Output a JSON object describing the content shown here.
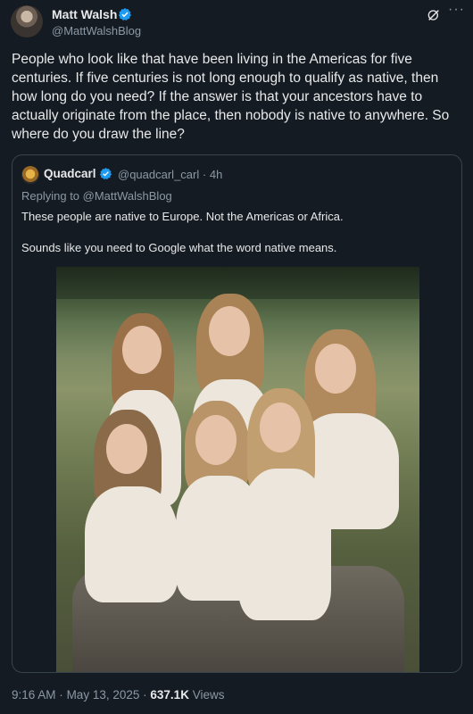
{
  "author": {
    "name": "Matt Walsh",
    "handle": "@MattWalshBlog",
    "verified": true
  },
  "tweet": {
    "text": "People who look like that have been living in the Americas for five centuries. If five centuries is not long enough to qualify as native, then how long do you need? If the answer is that your ancestors have to actually originate from the place, then nobody is native to anywhere. So where do you draw the line?"
  },
  "quote": {
    "name": "Quadcarl",
    "handle": "@quadcarl_carl",
    "separator": "·",
    "time": "4h",
    "replying_to": "Replying to @MattWalshBlog",
    "line1": "These people are native to Europe. Not the Americas or Africa.",
    "line2": "Sounds like you need to Google what the word native means."
  },
  "footer": {
    "time": "9:16 AM",
    "date": "May 13, 2025",
    "separator": "·",
    "views_count": "637.1K",
    "views_label": "Views"
  },
  "icons": {
    "verified": "verified-badge-icon",
    "grok": "grok-icon",
    "more": "more-options-icon"
  },
  "colors": {
    "background": "#151b22",
    "text": "#e7e9ea",
    "secondary": "#8b98a5",
    "verified_blue": "#1d9bf0",
    "border": "#38444d"
  }
}
